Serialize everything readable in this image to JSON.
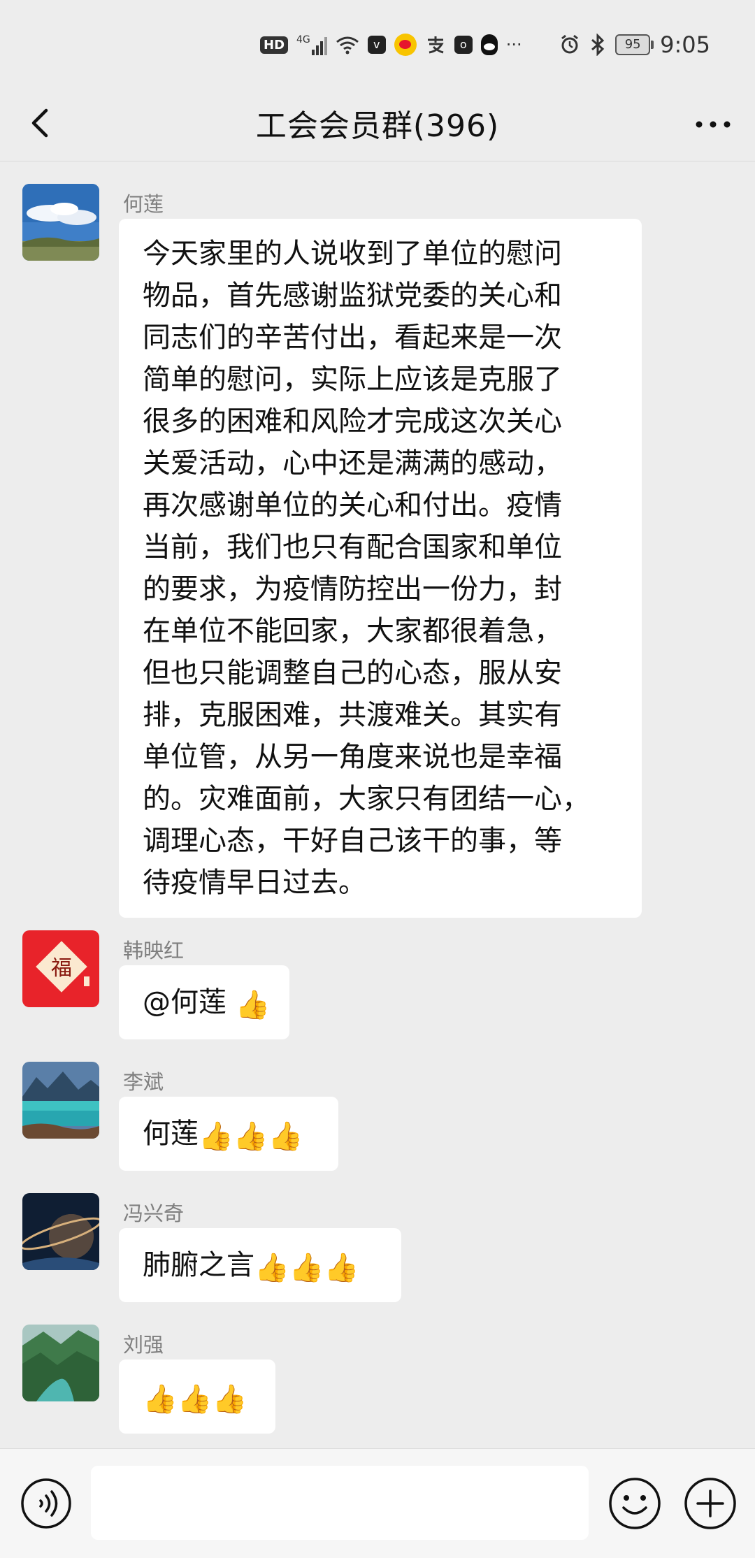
{
  "status_bar": {
    "hd": "HD",
    "network": "4G",
    "more": "···",
    "battery": "95",
    "time": "9:05"
  },
  "nav": {
    "title": "工会会员群(396)"
  },
  "messages": [
    {
      "sender": "何莲",
      "avatar": "sky-landscape-avatar",
      "text": "今天家里的人说收到了单位的慰问\n物品，首先感谢监狱党委的关心和\n同志们的辛苦付出，看起来是一次\n简单的慰问，实际上应该是克服了\n很多的困难和风险才完成这次关心\n关爱活动，心中还是满满的感动，\n再次感谢单位的关心和付出。疫情\n当前，我们也只有配合国家和单位\n的要求，为疫情防控出一份力，封\n在单位不能回家，大家都很着急，\n但也只能调整自己的心态，服从安\n排，克服困难，共渡难关。其实有\n单位管，从另一角度来说也是幸福\n的。灾难面前，大家只有团结一心，\n调理心态，干好自己该干的事，等\n待疫情早日过去。"
    },
    {
      "sender": "韩映红",
      "avatar": "fu-character-avatar",
      "text": "@何莲 ",
      "emoji_count": 1
    },
    {
      "sender": "李斌",
      "avatar": "lake-mountain-avatar",
      "text": "何莲",
      "emoji_count": 3
    },
    {
      "sender": "冯兴奇",
      "avatar": "planet-avatar",
      "text": "肺腑之言",
      "emoji_count": 3
    },
    {
      "sender": "刘强",
      "avatar": "valley-river-avatar",
      "text": "",
      "emoji_count": 3
    }
  ],
  "emoji": {
    "thumbs_up": "👍"
  },
  "avatar_text": {
    "fu": "福"
  },
  "input": {
    "placeholder": ""
  },
  "colors": {
    "background": "#ededed",
    "bubble": "#ffffff",
    "sender_name": "#7f7f7f",
    "text": "#111111"
  }
}
